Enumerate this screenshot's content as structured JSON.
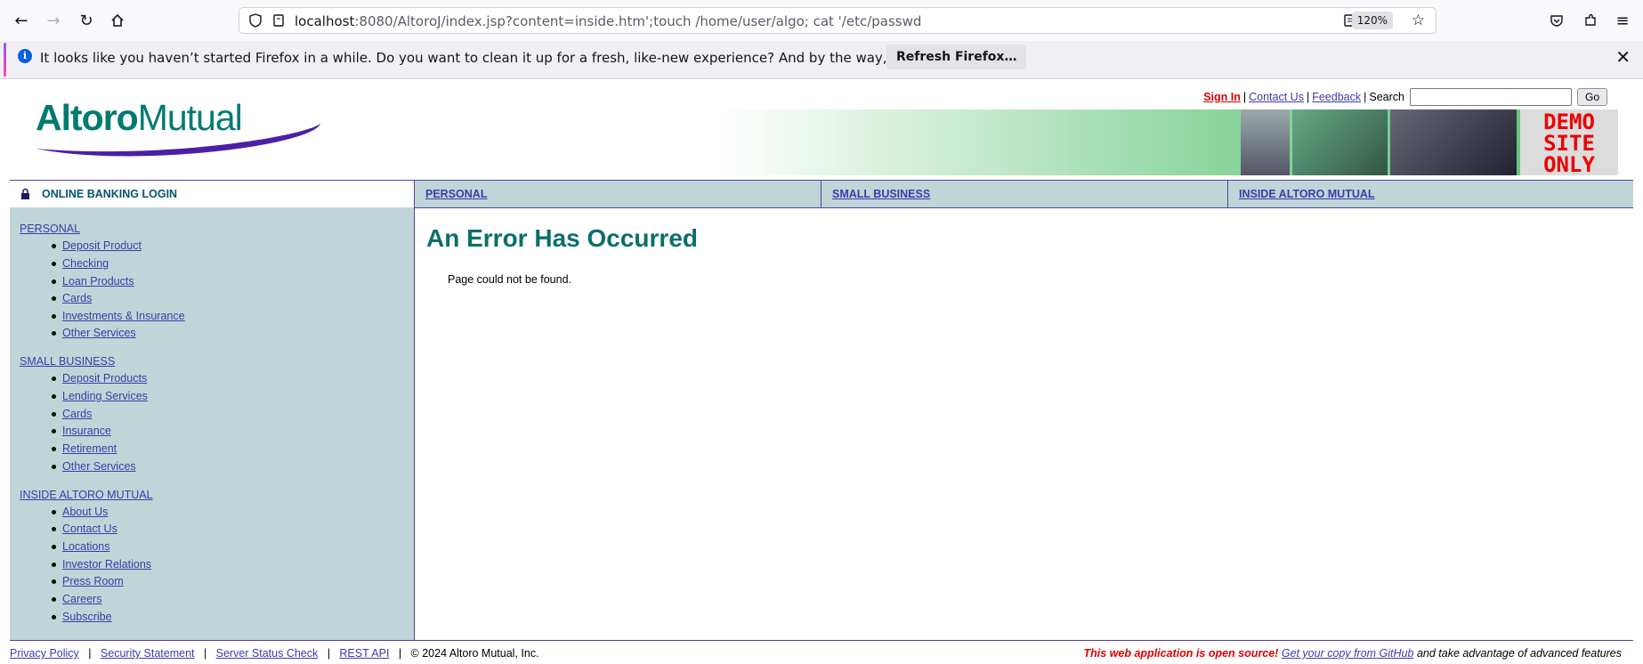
{
  "browser": {
    "url_host": "localhost",
    "url_rest": ":8080/AltoroJ/index.jsp?content=inside.htm';touch /home/user/algo; cat '/etc/passwd",
    "zoom": "120%"
  },
  "notification": {
    "text": "It looks like you haven’t started Firefox in a while. Do you want to clean it up for a fresh, like-new experience? And by the way, welcome back!",
    "button": "Refresh Firefox…"
  },
  "header": {
    "logo_bold": "Altoro",
    "logo_light": "Mutual",
    "sign_in": "Sign In",
    "contact_us": "Contact Us",
    "feedback": "Feedback",
    "search_label": "Search",
    "go_button": "Go",
    "demo_banner": "DEMO SITE ONLY"
  },
  "nav": {
    "login": "ONLINE BANKING LOGIN",
    "personal": "PERSONAL",
    "small_business": "SMALL BUSINESS",
    "inside": "INSIDE ALTORO MUTUAL"
  },
  "sidebar": {
    "personal": {
      "title": "PERSONAL",
      "items": [
        "Deposit Product",
        "Checking",
        "Loan Products",
        "Cards",
        "Investments & Insurance",
        "Other Services"
      ]
    },
    "small_business": {
      "title": "SMALL BUSINESS",
      "items": [
        "Deposit Products",
        "Lending Services",
        "Cards",
        "Insurance",
        "Retirement",
        "Other Services"
      ]
    },
    "inside": {
      "title": "INSIDE ALTORO MUTUAL",
      "items": [
        "About Us",
        "Contact Us",
        "Locations",
        "Investor Relations",
        "Press Room",
        "Careers",
        "Subscribe"
      ]
    }
  },
  "content": {
    "title": "An Error Has Occurred",
    "message": "Page could not be found."
  },
  "footer": {
    "privacy": "Privacy Policy",
    "security": "Security Statement",
    "server_status": "Server Status Check",
    "rest_api": "REST API",
    "copyright": "© 2024 Altoro Mutual, Inc.",
    "open_source": "This web application is open source!",
    "github_link": "Get your copy from GitHub",
    "tail": "and take advantage of advanced features"
  }
}
